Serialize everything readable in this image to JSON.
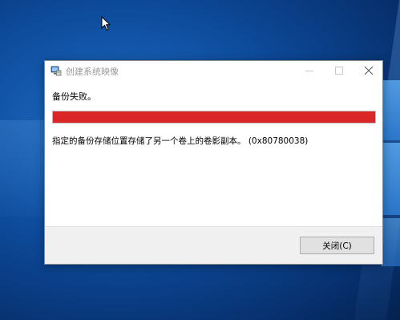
{
  "dialog": {
    "title": "创建系统映像",
    "heading": "备份失败。",
    "progress_fraction": 1.0,
    "progress_color": "#da2626",
    "message": "指定的备份存储位置存储了另一个卷上的卷影副本。 (0x80780038)",
    "close_button_label": "关闭(C)",
    "window_controls": {
      "minimize": "minimize-icon",
      "maximize": "maximize-icon",
      "close": "close-icon"
    }
  },
  "desktop": {
    "background_color": "#0d4a9a"
  }
}
